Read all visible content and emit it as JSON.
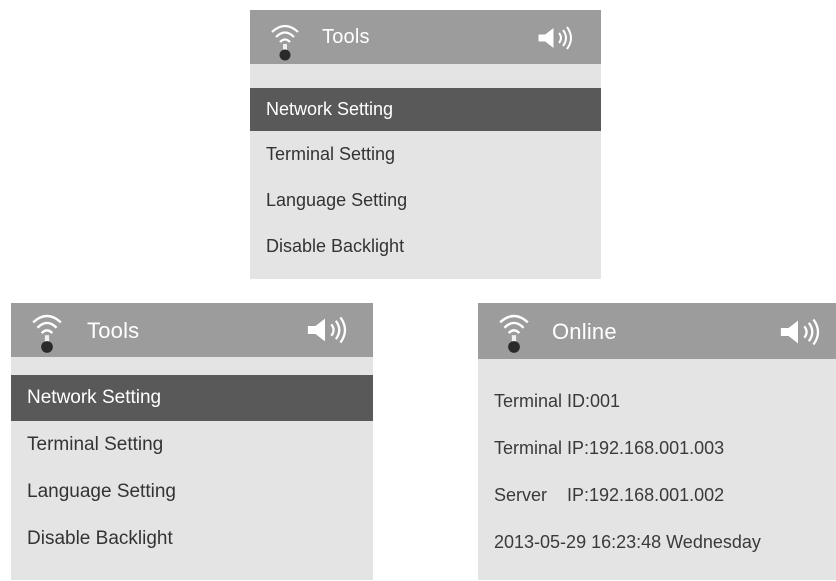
{
  "colors": {
    "header_bg": "#9c9c9c",
    "screen_bg": "#e4e4e4",
    "selected_bg": "#595959",
    "text": "#333333",
    "header_text": "#ffffff"
  },
  "screens": [
    {
      "title": "Tools",
      "icons": [
        "wifi-signal-icon",
        "speaker-volume-icon"
      ],
      "menu": [
        {
          "label": "Network Setting",
          "selected": true
        },
        {
          "label": "Terminal Setting",
          "selected": false
        },
        {
          "label": "Language Setting",
          "selected": false
        },
        {
          "label": "Disable Backlight",
          "selected": false
        }
      ]
    },
    {
      "title": "Tools",
      "icons": [
        "wifi-signal-icon",
        "speaker-volume-icon"
      ],
      "menu": [
        {
          "label": "Network Setting",
          "selected": true
        },
        {
          "label": "Terminal Setting",
          "selected": false
        },
        {
          "label": "Language Setting",
          "selected": false
        },
        {
          "label": "Disable Backlight",
          "selected": false
        }
      ]
    },
    {
      "title": "Online",
      "icons": [
        "wifi-signal-icon",
        "speaker-volume-icon"
      ],
      "info": [
        "Terminal ID:001",
        "Terminal IP:192.168.001.003",
        "Server    IP:192.168.001.002",
        "2013-05-29 16:23:48 Wednesday"
      ]
    }
  ]
}
